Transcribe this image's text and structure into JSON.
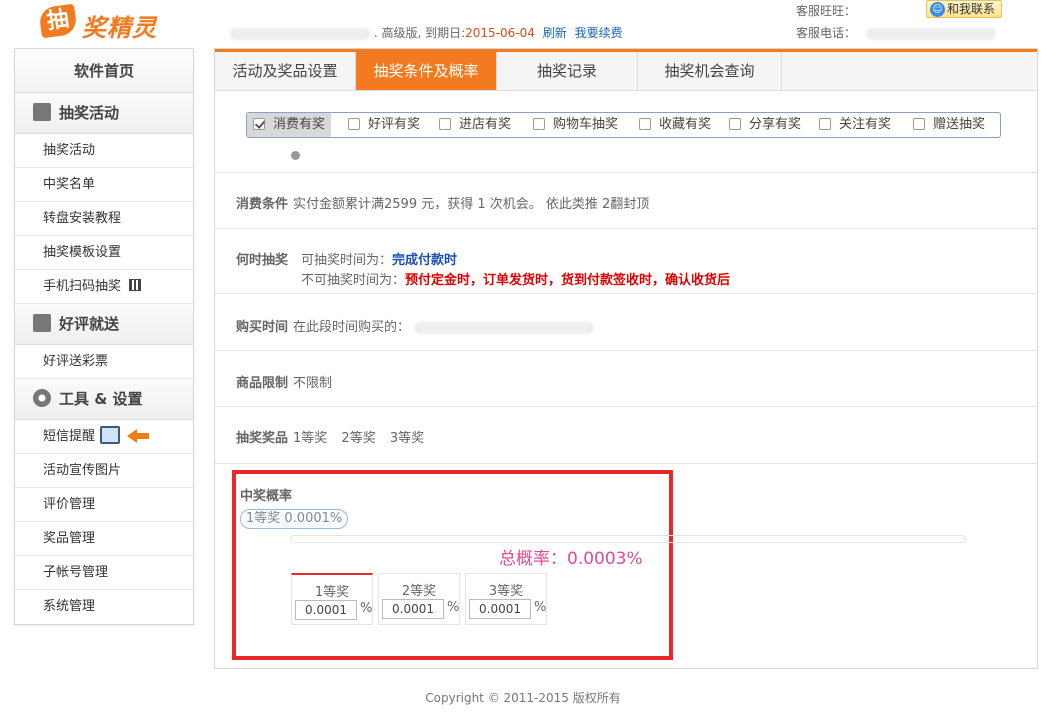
{
  "header": {
    "logo_mark": "抽",
    "logo_text": "奖精灵",
    "edition_text": ". 高级版, 到期日:",
    "expiry_date": "2015-06-04",
    "refresh_link": "刷新",
    "renew_link": "我要续费",
    "service_wangwang_label": "客服旺旺：",
    "contact_button": "和我联系",
    "service_phone_label": "客服电话："
  },
  "sidebar": {
    "home": "软件首页",
    "groups": [
      {
        "title": "抽奖活动",
        "icon": "gift-icon",
        "items": [
          "抽奖活动",
          "中奖名单",
          "转盘安装教程",
          "抽奖模板设置",
          "手机扫码抽奖"
        ]
      },
      {
        "title": "好评就送",
        "icon": "coupon-icon",
        "items": [
          "好评送彩票"
        ]
      },
      {
        "title": "工具 & 设置",
        "icon": "gear-icon",
        "items": [
          "短信提醒",
          "活动宣传图片",
          "评价管理",
          "奖品管理",
          "子帐号管理",
          "系统管理"
        ]
      }
    ]
  },
  "tabs": [
    "活动及奖品设置",
    "抽奖条件及概率",
    "抽奖记录",
    "抽奖机会查询"
  ],
  "active_tab": "抽奖条件及概率",
  "condition_tabs": [
    "消费有奖",
    "好评有奖",
    "进店有奖",
    "购物车抽奖",
    "收藏有奖",
    "分享有奖",
    "关注有奖",
    "赠送抽奖"
  ],
  "active_condition": "消费有奖",
  "rows": {
    "consume": {
      "label": "消费条件",
      "value": "实付金额累计满2599 元，获得 1 次机会。 依此类推 2翻封顶"
    },
    "when": {
      "label": "何时抽奖",
      "allowed_label": "可抽奖时间为：",
      "allowed_value": "完成付款时",
      "disallowed_label": "不可抽奖时间为：",
      "disallowed_value": "预付定金时，订单发货时，货到付款签收时，确认收货后"
    },
    "purchase_time": {
      "label": "购买时间",
      "value": "在此段时间购买的："
    },
    "goods": {
      "label": "商品限制",
      "value": "不限制"
    },
    "prizes": {
      "label": "抽奖奖品",
      "items": [
        "1等奖",
        "2等奖",
        "3等奖"
      ]
    }
  },
  "probability": {
    "title": "中奖概率",
    "tag": "1等奖 0.0001%",
    "total": "总概率：0.0003%",
    "cards": [
      {
        "name": "1等奖",
        "value": "0.0001",
        "unit": "%"
      },
      {
        "name": "2等奖",
        "value": "0.0001",
        "unit": "%"
      },
      {
        "name": "3等奖",
        "value": "0.0001",
        "unit": "%"
      }
    ]
  },
  "footer": "Copyright © 2011-2015 版权所有",
  "colors": {
    "accent": "#f47a1f",
    "highlight_border": "#e8282b",
    "total_text": "#e44b8e"
  }
}
